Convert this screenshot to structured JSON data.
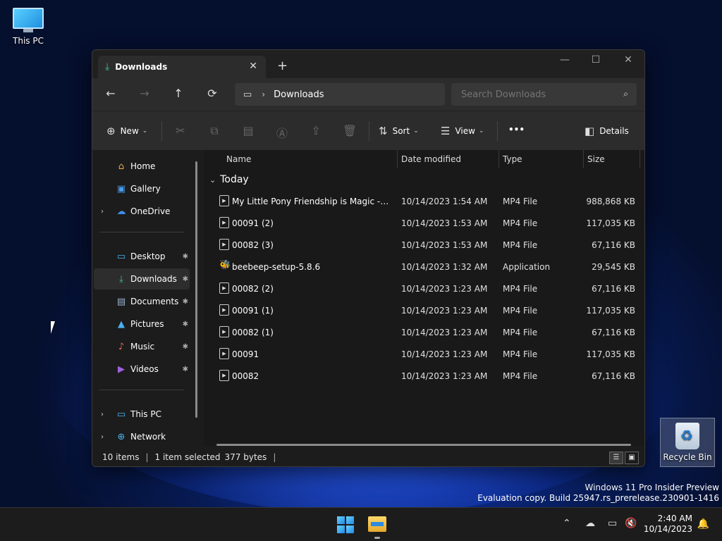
{
  "desktop": {
    "icons": [
      {
        "label": "This PC"
      },
      {
        "label": "Recycle Bin"
      }
    ],
    "watermark": {
      "line1": "Windows 11 Pro Insider Preview",
      "line2": "Evaluation copy. Build 25947.rs_prerelease.230901-1416"
    }
  },
  "window": {
    "tab": {
      "title": "Downloads",
      "close": "✕",
      "icon": "download-icon"
    },
    "new_tab": "+",
    "controls": {
      "minimize": "—",
      "maximize": "☐",
      "close": "✕"
    },
    "nav": {
      "back": "←",
      "forward": "→",
      "up": "↑",
      "refresh": "⟳"
    },
    "address": {
      "location_icon": "monitor-icon",
      "separator": "›",
      "crumb": "Downloads"
    },
    "search": {
      "placeholder": "Search Downloads",
      "icon": "search-icon"
    },
    "commands": {
      "new_label": "New",
      "sort_label": "Sort",
      "view_label": "View",
      "more_label": "•••",
      "details_label": "Details",
      "icons": [
        "cut-icon",
        "copy-icon",
        "paste-icon",
        "rename-icon",
        "share-icon",
        "delete-icon"
      ]
    },
    "sidebar": {
      "items": [
        {
          "label": "Home",
          "icon": "home-icon",
          "glyph": "⌂",
          "color": "#e8a84a"
        },
        {
          "label": "Gallery",
          "icon": "gallery-icon",
          "glyph": "▣",
          "color": "#4a9be8"
        },
        {
          "label": "OneDrive",
          "icon": "cloud-icon",
          "glyph": "☁",
          "color": "#3b8eea"
        },
        {
          "label": "Desktop",
          "icon": "desktop-icon",
          "glyph": "▭",
          "color": "#4ab0f0"
        },
        {
          "label": "Downloads",
          "icon": "download-icon",
          "glyph": "⤓",
          "color": "#3fc28a"
        },
        {
          "label": "Documents",
          "icon": "document-icon",
          "glyph": "▤",
          "color": "#9ab4d0"
        },
        {
          "label": "Pictures",
          "icon": "pictures-icon",
          "glyph": "▲",
          "color": "#4ab0f0"
        },
        {
          "label": "Music",
          "icon": "music-icon",
          "glyph": "♪",
          "color": "#e86a5a"
        },
        {
          "label": "Videos",
          "icon": "videos-icon",
          "glyph": "▶",
          "color": "#a060e0"
        },
        {
          "label": "This PC",
          "icon": "monitor-icon",
          "glyph": "▭",
          "color": "#4ab0f0"
        },
        {
          "label": "Network",
          "icon": "network-icon",
          "glyph": "⊕",
          "color": "#4ab0f0"
        }
      ],
      "expander": "›",
      "pin": "📌"
    },
    "columns": {
      "name": "Name",
      "date": "Date modified",
      "type": "Type",
      "size": "Size"
    },
    "group_label": "Today",
    "files": [
      {
        "name": "My Little Pony Friendship is Magic - Seas...",
        "date": "10/14/2023 1:54 AM",
        "type": "MP4 File",
        "size": "988,868 KB"
      },
      {
        "name": "00091 (2)",
        "date": "10/14/2023 1:53 AM",
        "type": "MP4 File",
        "size": "117,035 KB"
      },
      {
        "name": "00082 (3)",
        "date": "10/14/2023 1:53 AM",
        "type": "MP4 File",
        "size": "67,116 KB"
      },
      {
        "name": "beebeep-setup-5.8.6",
        "date": "10/14/2023 1:32 AM",
        "type": "Application",
        "size": "29,545 KB"
      },
      {
        "name": "00082 (2)",
        "date": "10/14/2023 1:23 AM",
        "type": "MP4 File",
        "size": "67,116 KB"
      },
      {
        "name": "00091 (1)",
        "date": "10/14/2023 1:23 AM",
        "type": "MP4 File",
        "size": "117,035 KB"
      },
      {
        "name": "00082 (1)",
        "date": "10/14/2023 1:23 AM",
        "type": "MP4 File",
        "size": "67,116 KB"
      },
      {
        "name": "00091",
        "date": "10/14/2023 1:23 AM",
        "type": "MP4 File",
        "size": "117,035 KB"
      },
      {
        "name": "00082",
        "date": "10/14/2023 1:23 AM",
        "type": "MP4 File",
        "size": "67,116 KB"
      }
    ],
    "status": {
      "count": "10 items",
      "selection": "1 item selected",
      "bytes": "377 bytes"
    }
  },
  "taskbar": {
    "time": "2:40 AM",
    "date": "10/14/2023",
    "tray_icons": [
      "chevron-up-icon",
      "onedrive-icon",
      "network-icon",
      "volume-muted-icon",
      "notification-bell-icon"
    ]
  },
  "colors": {
    "accent": "#4aa3ff",
    "window_bg": "#1c1c1c",
    "toolbar_bg": "#2c2c2c"
  }
}
